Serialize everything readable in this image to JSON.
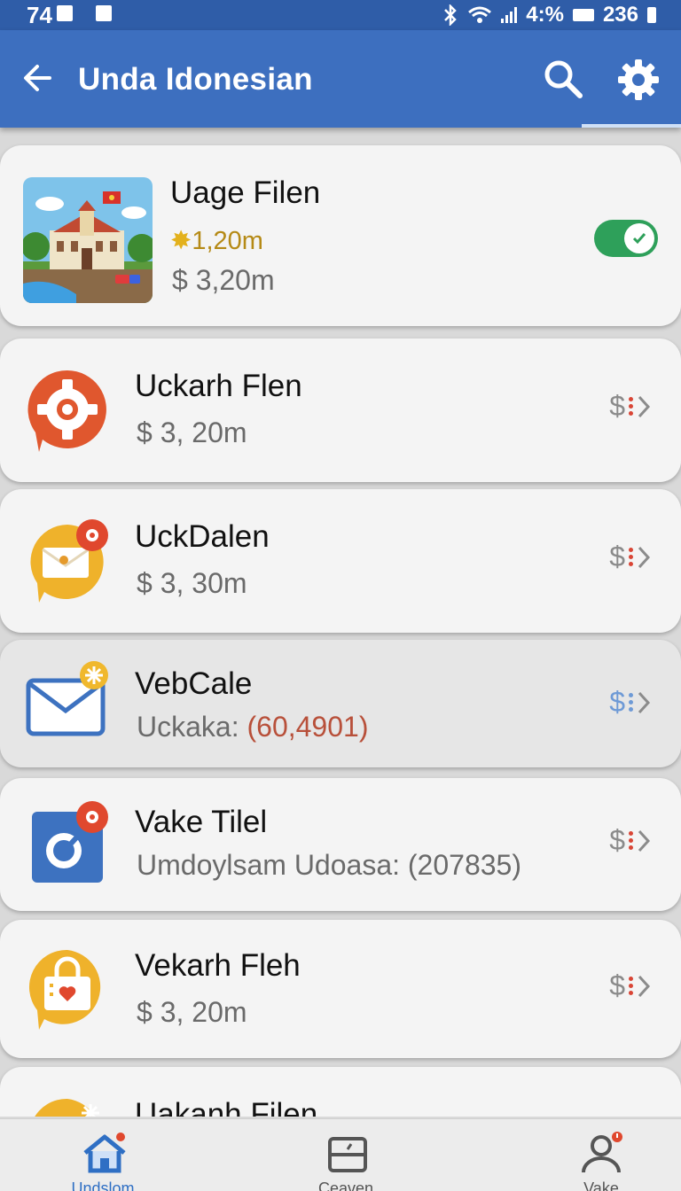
{
  "status_bar": {
    "time": "74",
    "battery": "4:%",
    "clock": "236"
  },
  "app_bar": {
    "title": "Unda Idonesian"
  },
  "items": [
    {
      "name": "Uage Filen",
      "rating": "1,20m",
      "price": "$ 3,20m",
      "toggle_on": true
    },
    {
      "name": "Uckarh Flen",
      "sub": "$ 3, 20m",
      "trail": "$"
    },
    {
      "name": "UckDalen",
      "sub": "$ 3, 30m",
      "trail": "$"
    },
    {
      "name": "VebCale",
      "sub_label": "Uckaka:",
      "sub_value": "(60,4901)",
      "trail": "$"
    },
    {
      "name": "Vake Tilel",
      "sub": "Umdoylsam Udoasa: (207835)",
      "trail": "$"
    },
    {
      "name": "Vekarh Fleh",
      "sub": "$ 3, 20m",
      "trail": "$"
    },
    {
      "name": "Uakanh Filen"
    }
  ],
  "bottom_nav": [
    {
      "label": "Undslom",
      "icon": "home-icon",
      "active": true
    },
    {
      "label": "Ceaven",
      "icon": "wallet-icon",
      "active": false
    },
    {
      "label": "Vake",
      "icon": "profile-icon",
      "active": false
    }
  ],
  "colors": {
    "app_bar": "#3d6fbf",
    "status_bar": "#2f5da8",
    "toggle": "#2ea05a",
    "accent_red": "#d94535"
  }
}
